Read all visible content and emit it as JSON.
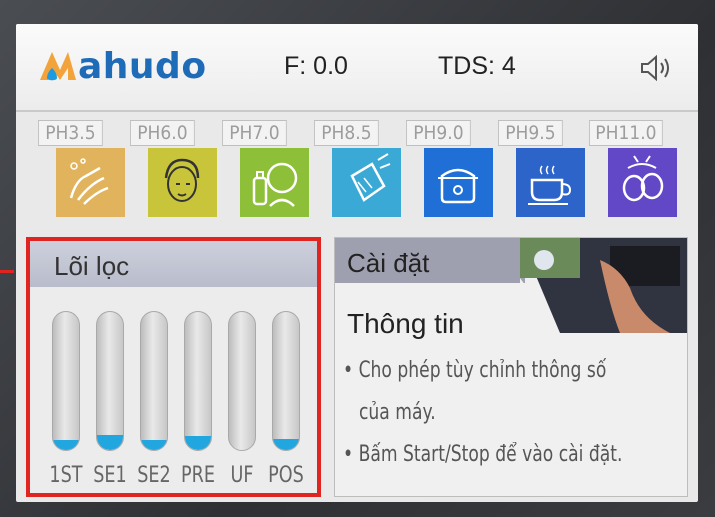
{
  "header": {
    "logo": "ahudo",
    "flow": "F: 0.0",
    "tds": "TDS: 4",
    "speaker_icon": "speaker-icon"
  },
  "ph_modes": [
    {
      "label": "PH3.5",
      "color": "#e1b35c",
      "icon": "hand-wash-icon"
    },
    {
      "label": "PH6.0",
      "color": "#c9c53a",
      "icon": "face-care-icon"
    },
    {
      "label": "PH7.0",
      "color": "#8dbf38",
      "icon": "baby-bottle-icon"
    },
    {
      "label": "PH8.5",
      "color": "#3aa9d6",
      "icon": "water-glass-icon"
    },
    {
      "label": "PH9.0",
      "color": "#1f6fd7",
      "icon": "rice-cooker-icon"
    },
    {
      "label": "PH9.5",
      "color": "#2c64c9",
      "icon": "coffee-cup-icon"
    },
    {
      "label": "PH11.0",
      "color": "#6247c7",
      "icon": "vegetable-wash-icon"
    }
  ],
  "filter": {
    "title": "Lõi lọc",
    "tubes": [
      {
        "label": "1ST",
        "level": 0.07
      },
      {
        "label": "SE1",
        "level": 0.11
      },
      {
        "label": "SE2",
        "level": 0.07
      },
      {
        "label": "PRE",
        "level": 0.1
      },
      {
        "label": "UF",
        "level": 0.0
      },
      {
        "label": "POS",
        "level": 0.08
      }
    ]
  },
  "settings": {
    "title": "Cài đặt",
    "info_title": "Thông tin",
    "lines": [
      "• Cho phép tùy chỉnh thông số",
      "của máy.",
      "• Bấm Start/Stop để vào cài đặt."
    ]
  }
}
